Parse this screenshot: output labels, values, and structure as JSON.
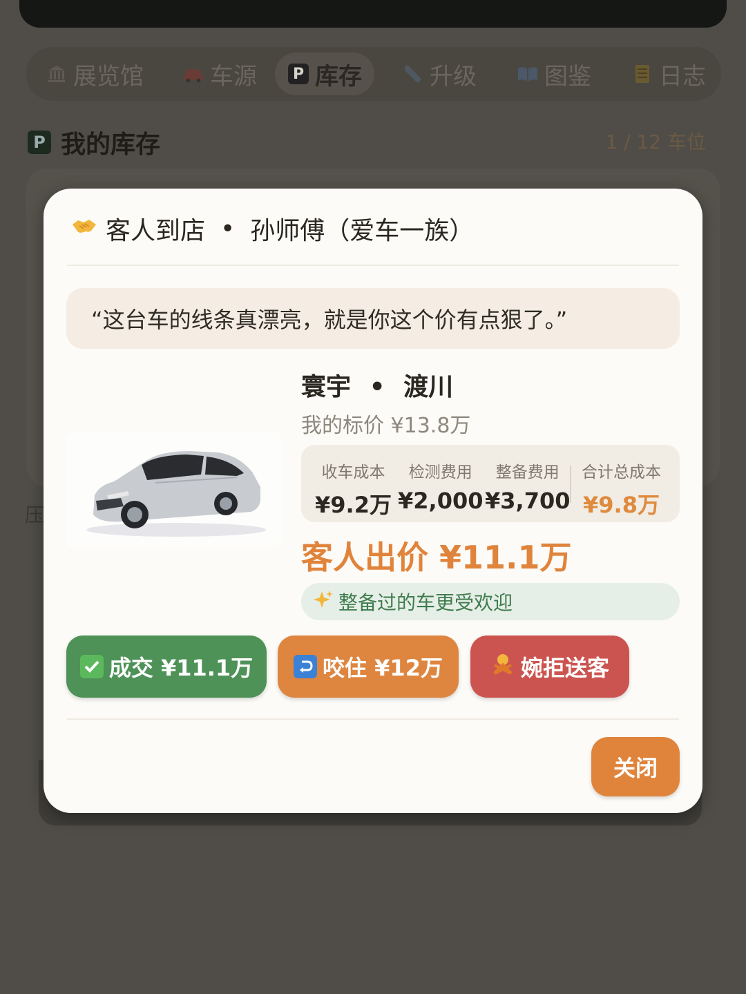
{
  "nav": {
    "tabs": [
      {
        "label": "展览馆",
        "icon": "museum-icon"
      },
      {
        "label": "车源",
        "icon": "car-icon"
      },
      {
        "label": "库存",
        "icon": "parking-icon",
        "active": true
      },
      {
        "label": "升级",
        "icon": "wrench-icon"
      },
      {
        "label": "图鉴",
        "icon": "book-icon"
      },
      {
        "label": "日志",
        "icon": "ledger-icon"
      }
    ]
  },
  "inventory": {
    "title": "我的库存",
    "slots": "1 / 12 车位",
    "side_text": "压"
  },
  "modal": {
    "header": {
      "title": "客人到店",
      "separator": "•",
      "customer": "孙师傅（爱车一族）"
    },
    "quote": "“这台车的线条真漂亮，就是你这个价有点狠了。”",
    "car": {
      "brand": "寰宇",
      "separator": "•",
      "model": "渡川",
      "list_price": "我的标价 ¥13.8万"
    },
    "costs": [
      {
        "label": "收车成本",
        "value": "¥9.2万"
      },
      {
        "label": "检测费用",
        "value": "¥2,000"
      },
      {
        "label": "整备费用",
        "value": "¥3,700"
      }
    ],
    "total_cost": {
      "label": "合计总成本",
      "value": "¥9.8万"
    },
    "offer": "客人出价 ¥11.1万",
    "tip": "整备过的车更受欢迎",
    "buttons": {
      "accept": "成交 ¥11.1万",
      "counter": "咬住 ¥12万",
      "reject": "婉拒送客",
      "close": "关闭"
    }
  },
  "colors": {
    "accent_orange": "#e0843c",
    "accept_green": "#4e9257",
    "reject_red": "#cc5450",
    "total_cost": "#df8a3c",
    "tip_green": "#3f7b4d"
  }
}
